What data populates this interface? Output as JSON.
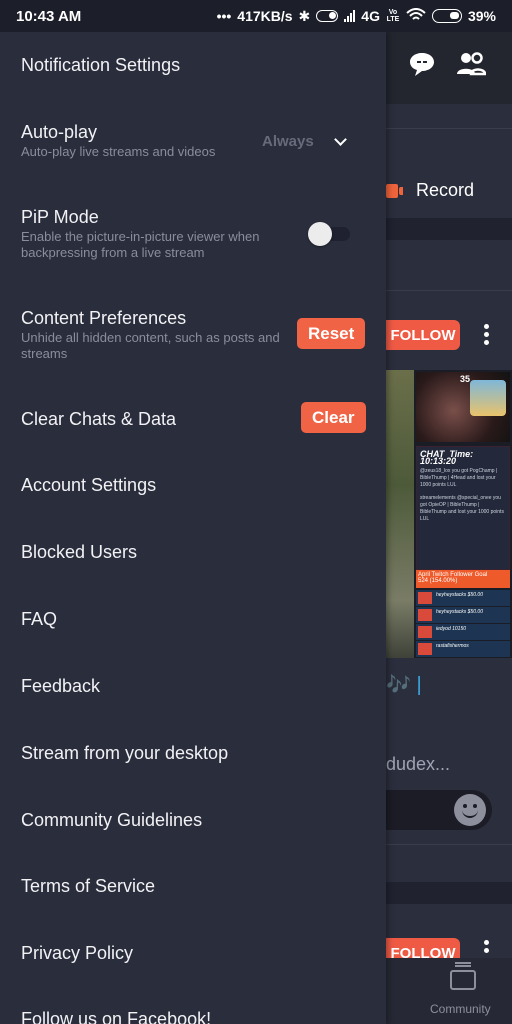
{
  "status_bar": {
    "time": "10:43 AM",
    "more": "•••",
    "network_speed": "417KB/s",
    "network_type": "4G",
    "volte": "Vo LTE",
    "battery": "39%"
  },
  "background_app": {
    "record_label": "Record",
    "follow_label": "FOLLOW",
    "emoji_line": "🎶 |",
    "author_snippet": "dudex...",
    "thumbnail": {
      "cam_counter": "35",
      "chat_header": "CHAT",
      "chat_time": "Time: 10:13:20",
      "chat_msg_1": "@zeus18_lox you got PogChamp | BibleThump | 4Head and lost your 1000 points LUL",
      "chat_msg_2": "streamelements @special_onee you got OpieOP | BibleThump | BibleThump and lost your 1000 points LUL",
      "goal_title": "April Twitch Follower Goal",
      "goal_value": "524 (154.00%)",
      "rows": [
        {
          "label": "TOP TIP",
          "value": "heyheystacks $50.00"
        },
        {
          "label": "TOP TIP",
          "value": "heyheystacks $50.00"
        },
        {
          "label": "TOP CHEER",
          "value": "iedyod 10150"
        },
        {
          "label": "NEW SUBSCRIBER",
          "value": "rastafishermos"
        }
      ]
    },
    "bottom_nav": {
      "community_label": "Community"
    }
  },
  "drawer": {
    "items": [
      {
        "title": "Notification Settings"
      },
      {
        "title": "Auto-play",
        "subtitle": "Auto-play live streams and videos",
        "value": "Always"
      },
      {
        "title": "PiP Mode",
        "subtitle": "Enable the picture-in-picture viewer when backpressing from a live stream",
        "enabled": false
      },
      {
        "title": "Content Preferences",
        "subtitle": "Unhide all hidden content, such as posts and streams",
        "button": "Reset"
      },
      {
        "title": "Clear Chats & Data",
        "button": "Clear"
      },
      {
        "title": "Account Settings"
      },
      {
        "title": "Blocked Users"
      },
      {
        "title": "FAQ"
      },
      {
        "title": "Feedback"
      },
      {
        "title": "Stream from your desktop"
      },
      {
        "title": "Community Guidelines"
      },
      {
        "title": "Terms of Service"
      },
      {
        "title": "Privacy Policy"
      },
      {
        "title": "Follow us on Facebook!"
      }
    ]
  },
  "colors": {
    "accent": "#f06445",
    "drawer_bg": "#2a2d3c",
    "status_bar_bg": "#1c1e29"
  }
}
